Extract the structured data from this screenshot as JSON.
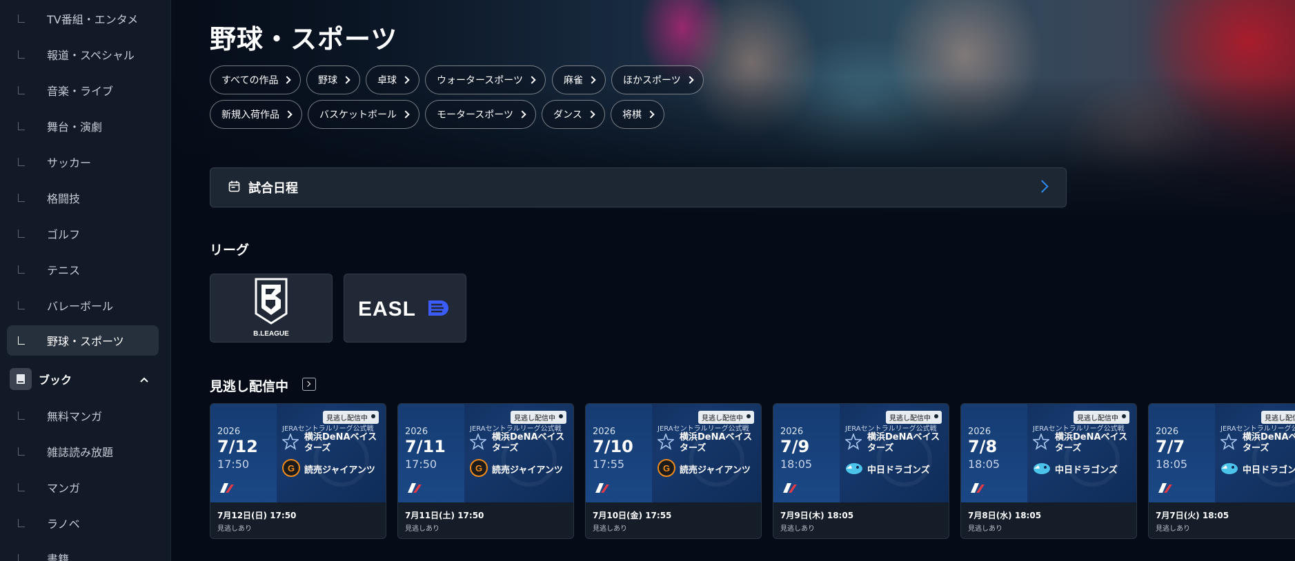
{
  "sidebar": {
    "items": [
      {
        "label": "TV番組・エンタメ"
      },
      {
        "label": "報道・スペシャル"
      },
      {
        "label": "音楽・ライブ"
      },
      {
        "label": "舞台・演劇"
      },
      {
        "label": "サッカー"
      },
      {
        "label": "格闘技"
      },
      {
        "label": "ゴルフ"
      },
      {
        "label": "テニス"
      },
      {
        "label": "バレーボール"
      },
      {
        "label": "野球・スポーツ",
        "active": true
      }
    ],
    "section_book": {
      "label": "ブック"
    },
    "book_items": [
      {
        "label": "無料マンガ"
      },
      {
        "label": "雑誌読み放題"
      },
      {
        "label": "マンガ"
      },
      {
        "label": "ラノベ"
      },
      {
        "label": "書籍"
      }
    ]
  },
  "page": {
    "title": "野球・スポーツ"
  },
  "genre_chips": {
    "row1": [
      {
        "label": "すべての作品"
      },
      {
        "label": "野球"
      },
      {
        "label": "卓球"
      },
      {
        "label": "ウォータースポーツ"
      },
      {
        "label": "麻雀"
      },
      {
        "label": "ほかスポーツ"
      }
    ],
    "row2": [
      {
        "label": "新規入荷作品"
      },
      {
        "label": "バスケットボール"
      },
      {
        "label": "モータースポーツ"
      },
      {
        "label": "ダンス"
      },
      {
        "label": "将棋"
      }
    ]
  },
  "schedule": {
    "label": "試合日程",
    "icon": "calendar-icon"
  },
  "league_section": {
    "title": "リーグ",
    "leagues": [
      {
        "name": "B.LEAGUE",
        "logo_text": "B.LEAGUE"
      },
      {
        "name": "EASL",
        "logo_text": "EASL"
      }
    ]
  },
  "catchup_section": {
    "title": "見逃し配信中",
    "cards": [
      {
        "badge": "見逃し配信中",
        "year": "2026",
        "date": "7/12",
        "time": "17:50",
        "league": "JERAセントラルリーグ公式戦",
        "team1": "横浜DeNAベイスターズ",
        "team2": "読売ジャイアンツ",
        "team2_logo": "giants",
        "footer_date": "7月12日(日) 17:50",
        "footer_note": "見逃しあり"
      },
      {
        "badge": "見逃し配信中",
        "year": "2026",
        "date": "7/11",
        "time": "17:50",
        "league": "JERAセントラルリーグ公式戦",
        "team1": "横浜DeNAベイスターズ",
        "team2": "読売ジャイアンツ",
        "team2_logo": "giants",
        "footer_date": "7月11日(土) 17:50",
        "footer_note": "見逃しあり"
      },
      {
        "badge": "見逃し配信中",
        "year": "2026",
        "date": "7/10",
        "time": "17:55",
        "league": "JERAセントラルリーグ公式戦",
        "team1": "横浜DeNAベイスターズ",
        "team2": "読売ジャイアンツ",
        "team2_logo": "giants",
        "footer_date": "7月10日(金) 17:55",
        "footer_note": "見逃しあり"
      },
      {
        "badge": "見逃し配信中",
        "year": "2026",
        "date": "7/9",
        "time": "18:05",
        "league": "JERAセントラルリーグ公式戦",
        "team1": "横浜DeNAベイスターズ",
        "team2": "中日ドラゴンズ",
        "team2_logo": "dragons",
        "footer_date": "7月9日(木) 18:05",
        "footer_note": "見逃しあり"
      },
      {
        "badge": "見逃し配信中",
        "year": "2026",
        "date": "7/8",
        "time": "18:05",
        "league": "JERAセントラルリーグ公式戦",
        "team1": "横浜DeNAベイスターズ",
        "team2": "中日ドラゴンズ",
        "team2_logo": "dragons",
        "footer_date": "7月8日(水) 18:05",
        "footer_note": "見逃しあり"
      },
      {
        "badge": "見逃し配信中",
        "year": "2026",
        "date": "7/7",
        "time": "18:05",
        "league": "JERAセントラルリーグ公式戦",
        "team1": "横浜DeNAベイスターズ",
        "team2": "中日ドラゴンズ",
        "team2_logo": "dragons",
        "footer_date": "7月7日(火) 18:05",
        "footer_note": "見逃しあり"
      }
    ]
  },
  "colors": {
    "background": "#050c17",
    "sidebar": "#111a26",
    "accent": "#2d8cf0",
    "card_blue": "#16386c"
  }
}
